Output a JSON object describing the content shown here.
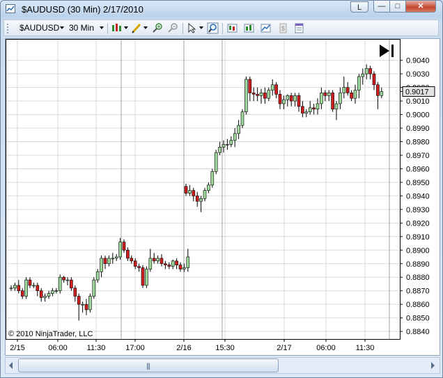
{
  "window": {
    "title": "$AUDUSD (30 Min)  2/17/2010",
    "help_label": "L",
    "minimize_label": "—",
    "maximize_label": "□",
    "close_label": "✕"
  },
  "toolbar": {
    "instrument": "$AUDUSD",
    "interval": "30 Min",
    "icons": [
      "bar-style-icon",
      "pencil-draw-icon",
      "zoom-in-icon",
      "zoom-out-icon",
      "cursor-icon",
      "magnify-icon",
      "data-box-icon",
      "indicators-icon",
      "strategies-icon",
      "properties-icon",
      "template-icon"
    ]
  },
  "chart": {
    "copyright": "© 2010 NinjaTrader, LLC",
    "last_price": "0.9017",
    "colors": {
      "up": "#9ed89a",
      "down": "#d01e1e",
      "grid": "#d9d9d9",
      "session": "#a0a0a0"
    }
  },
  "chart_data": {
    "type": "candlestick",
    "x_tick_labels": [
      "2/15",
      "06:00",
      "11:30",
      "17:00",
      "2/16",
      "15:30",
      "2/17",
      "06:00",
      "11:30"
    ],
    "y_tick_labels": [
      "0.9040",
      "0.9030",
      "0.9020",
      "0.9010",
      "0.9000",
      "0.8990",
      "0.8980",
      "0.8970",
      "0.8960",
      "0.8950",
      "0.8940",
      "0.8930",
      "0.8920",
      "0.8910",
      "0.8900",
      "0.8890",
      "0.8880",
      "0.8870",
      "0.8860",
      "0.8850",
      "0.8840"
    ],
    "ylim": [
      0.8838,
      0.9046
    ],
    "grid": true,
    "last_price": 0.9017,
    "segments": [
      {
        "open": [
          0.8872,
          0.8872,
          0.8874,
          0.887,
          0.8866,
          0.8878,
          0.8874,
          0.8874,
          0.887,
          0.8865,
          0.8866,
          0.8868,
          0.887,
          0.887,
          0.888,
          0.8878,
          0.8878,
          0.8872,
          0.8866,
          0.886,
          0.886,
          0.8856,
          0.8866,
          0.8878,
          0.8884,
          0.8894,
          0.889,
          0.8894,
          0.8894,
          0.8895,
          0.8906,
          0.89,
          0.8894,
          0.8892,
          0.8888,
          0.8887,
          0.8874,
          0.8886,
          0.8894,
          0.8892,
          0.8894,
          0.889,
          0.8889,
          0.8888,
          0.8892,
          0.8889,
          0.8886,
          0.8887
        ],
        "close": [
          0.8872,
          0.8874,
          0.887,
          0.8866,
          0.8878,
          0.8874,
          0.8874,
          0.887,
          0.8865,
          0.8866,
          0.8868,
          0.887,
          0.887,
          0.888,
          0.8878,
          0.8878,
          0.8872,
          0.8866,
          0.886,
          0.886,
          0.8856,
          0.8866,
          0.8878,
          0.8884,
          0.8894,
          0.889,
          0.8894,
          0.8894,
          0.8895,
          0.8906,
          0.89,
          0.8894,
          0.8892,
          0.8888,
          0.8887,
          0.8874,
          0.8886,
          0.8894,
          0.8892,
          0.8894,
          0.889,
          0.8889,
          0.8888,
          0.8892,
          0.8889,
          0.8886,
          0.8887,
          0.8895
        ],
        "high": [
          0.8874,
          0.8876,
          0.8878,
          0.8872,
          0.888,
          0.888,
          0.8876,
          0.8876,
          0.8872,
          0.8868,
          0.887,
          0.8872,
          0.8872,
          0.8882,
          0.8881,
          0.888,
          0.888,
          0.8874,
          0.8868,
          0.8862,
          0.8864,
          0.8868,
          0.888,
          0.8886,
          0.8896,
          0.8896,
          0.8896,
          0.8898,
          0.8897,
          0.8909,
          0.8908,
          0.8902,
          0.8896,
          0.8894,
          0.889,
          0.8889,
          0.8888,
          0.8901,
          0.8898,
          0.8896,
          0.8897,
          0.8892,
          0.8891,
          0.8893,
          0.8894,
          0.8891,
          0.889,
          0.8901
        ],
        "low": [
          0.887,
          0.887,
          0.8868,
          0.8864,
          0.8864,
          0.8872,
          0.8872,
          0.8866,
          0.8862,
          0.8862,
          0.8864,
          0.8866,
          0.8868,
          0.8868,
          0.8876,
          0.8874,
          0.887,
          0.8862,
          0.8848,
          0.8854,
          0.8852,
          0.8854,
          0.8864,
          0.8876,
          0.888,
          0.8886,
          0.8888,
          0.889,
          0.8892,
          0.8893,
          0.8898,
          0.8892,
          0.889,
          0.8886,
          0.8884,
          0.8872,
          0.8872,
          0.8884,
          0.889,
          0.889,
          0.8888,
          0.8886,
          0.8886,
          0.8886,
          0.8886,
          0.8884,
          0.8884,
          0.8884
        ]
      },
      {
        "open": [
          0.8947,
          0.8942,
          0.8944,
          0.894,
          0.8936,
          0.8938,
          0.8944,
          0.8948,
          0.8958,
          0.8972,
          0.8976,
          0.8978,
          0.8978,
          0.8981,
          0.8986,
          0.8992,
          0.9002,
          0.9026,
          0.9016,
          0.9015,
          0.9014,
          0.9016,
          0.9012,
          0.9018,
          0.9022,
          0.9015,
          0.9008,
          0.9011,
          0.9014,
          0.901,
          0.9014,
          0.9006,
          0.9001,
          0.9002,
          0.9005,
          0.9004,
          0.9008,
          0.9016,
          0.9014,
          0.9016,
          0.9004,
          0.9008,
          0.9016,
          0.902,
          0.9016,
          0.9012,
          0.9018,
          0.9028,
          0.903,
          0.9034,
          0.903,
          0.9022,
          0.9014
        ],
        "close": [
          0.8942,
          0.8944,
          0.894,
          0.8936,
          0.8938,
          0.8944,
          0.8948,
          0.8958,
          0.8972,
          0.8976,
          0.8978,
          0.8978,
          0.8981,
          0.8986,
          0.8992,
          0.9002,
          0.9026,
          0.9016,
          0.9015,
          0.9014,
          0.9016,
          0.9012,
          0.9018,
          0.9022,
          0.9015,
          0.9008,
          0.9011,
          0.9014,
          0.901,
          0.9014,
          0.9006,
          0.9001,
          0.9002,
          0.9005,
          0.9004,
          0.9008,
          0.9016,
          0.9014,
          0.9016,
          0.9004,
          0.9008,
          0.9016,
          0.902,
          0.9016,
          0.9012,
          0.9018,
          0.9028,
          0.903,
          0.9034,
          0.903,
          0.9022,
          0.9014,
          0.9017
        ],
        "high": [
          0.8949,
          0.8948,
          0.8946,
          0.8943,
          0.894,
          0.8946,
          0.895,
          0.896,
          0.8974,
          0.898,
          0.8981,
          0.8982,
          0.8984,
          0.899,
          0.8996,
          0.9004,
          0.9028,
          0.9028,
          0.902,
          0.902,
          0.9019,
          0.902,
          0.902,
          0.9026,
          0.9024,
          0.9018,
          0.9014,
          0.9015,
          0.9016,
          0.9016,
          0.9016,
          0.901,
          0.9004,
          0.901,
          0.9008,
          0.9012,
          0.902,
          0.9018,
          0.9018,
          0.9018,
          0.901,
          0.902,
          0.9028,
          0.9024,
          0.9018,
          0.9022,
          0.903,
          0.9034,
          0.9037,
          0.9036,
          0.9032,
          0.9024,
          0.902
        ],
        "low": [
          0.894,
          0.894,
          0.8936,
          0.8932,
          0.8928,
          0.8936,
          0.8942,
          0.8946,
          0.8956,
          0.897,
          0.8972,
          0.8974,
          0.8976,
          0.8976,
          0.8982,
          0.899,
          0.9,
          0.901,
          0.901,
          0.901,
          0.9008,
          0.9008,
          0.901,
          0.9014,
          0.9012,
          0.9004,
          0.9004,
          0.9006,
          0.9006,
          0.9006,
          0.9002,
          0.8998,
          0.8998,
          0.9,
          0.9,
          0.9,
          0.9004,
          0.901,
          0.901,
          0.9002,
          0.8996,
          0.9004,
          0.9012,
          0.9014,
          0.901,
          0.9008,
          0.9012,
          0.9022,
          0.9026,
          0.9026,
          0.9018,
          0.9004,
          0.9012
        ]
      }
    ]
  }
}
